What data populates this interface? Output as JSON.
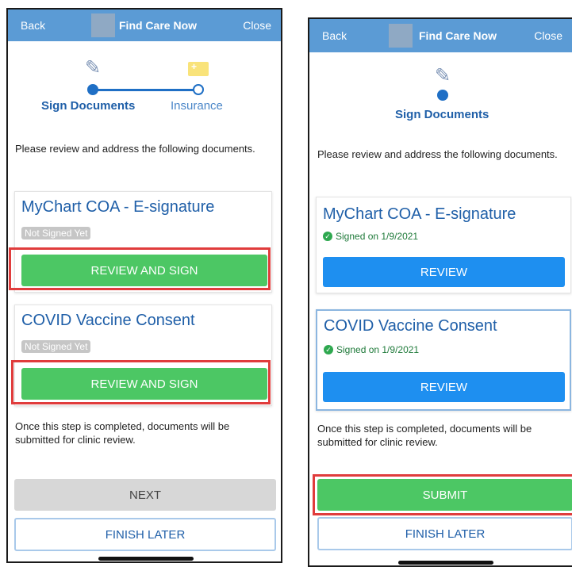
{
  "left": {
    "topbar": {
      "back": "Back",
      "title": "Find Care Now",
      "close": "Close"
    },
    "steps": {
      "step1": "Sign Documents",
      "step2": "Insurance"
    },
    "intro": "Please review and address the following documents.",
    "documents": [
      {
        "title": "MyChart COA - E-signature",
        "status": "Not Signed Yet",
        "button": "REVIEW AND SIGN"
      },
      {
        "title": "COVID Vaccine Consent",
        "status": "Not Signed Yet",
        "button": "REVIEW AND SIGN"
      }
    ],
    "note": "Once this step is completed, documents will be submitted for clinic review.",
    "next_button": "NEXT",
    "finish_later": "FINISH LATER"
  },
  "right": {
    "topbar": {
      "back": "Back",
      "title": "Find Care Now",
      "close": "Close"
    },
    "steps": {
      "step1": "Sign Documents"
    },
    "intro": "Please review and address the following documents.",
    "documents": [
      {
        "title": "MyChart COA - E-signature",
        "status": "Signed on 1/9/2021",
        "button": "REVIEW"
      },
      {
        "title": "COVID Vaccine Consent",
        "status": "Signed on 1/9/2021",
        "button": "REVIEW"
      }
    ],
    "note": "Once this step is completed, documents will be submitted for clinic review.",
    "submit_button": "SUBMIT",
    "finish_later": "FINISH LATER"
  },
  "colors": {
    "topbar": "#5b9bd5",
    "green_button": "#4cc764",
    "blue_button": "#1e8ff0",
    "highlight_red": "#e03c3c",
    "link_blue": "#1f5fa8"
  },
  "icons": [
    "pen-icon",
    "insurance-card-icon",
    "check-circle-icon"
  ]
}
